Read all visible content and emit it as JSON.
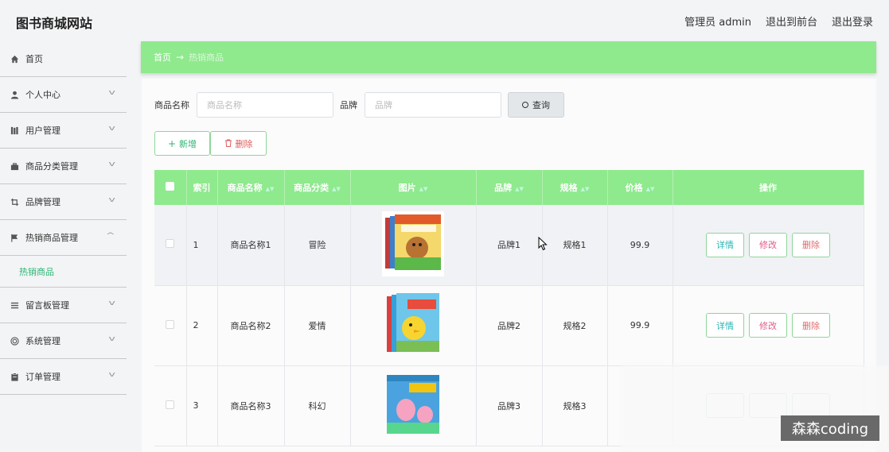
{
  "header": {
    "site_title": "图书商城网站",
    "admin_label": "管理员 admin",
    "front_link": "退出到前台",
    "logout_link": "退出登录"
  },
  "sidebar": {
    "items": [
      {
        "label": "首页",
        "icon": "home-icon"
      },
      {
        "label": "个人中心",
        "icon": "user-icon"
      },
      {
        "label": "用户管理",
        "icon": "books-icon"
      },
      {
        "label": "商品分类管理",
        "icon": "briefcase-icon"
      },
      {
        "label": "品牌管理",
        "icon": "crop-icon"
      },
      {
        "label": "热销商品管理",
        "icon": "flag-icon"
      },
      {
        "label": "留言板管理",
        "icon": "list-icon"
      },
      {
        "label": "系统管理",
        "icon": "settings-icon"
      },
      {
        "label": "订单管理",
        "icon": "clipboard-icon"
      }
    ],
    "active_sub": "热销商品"
  },
  "breadcrumb": {
    "home": "首页",
    "arrow": "→",
    "current": "热销商品"
  },
  "search": {
    "name_label": "商品名称",
    "name_placeholder": "商品名称",
    "brand_label": "品牌",
    "brand_placeholder": "品牌",
    "query_button": "查询"
  },
  "actions": {
    "add_label": "新增",
    "delete_label": "删除"
  },
  "table": {
    "headers": [
      "索引",
      "商品名称",
      "商品分类",
      "图片",
      "品牌",
      "规格",
      "价格",
      "操作"
    ],
    "rows": [
      {
        "index": "1",
        "name": "商品名称1",
        "category": "冒险",
        "brand": "品牌1",
        "spec": "规格1",
        "price": "99.9"
      },
      {
        "index": "2",
        "name": "商品名称2",
        "category": "爱情",
        "brand": "品牌2",
        "spec": "规格2",
        "price": "99.9"
      },
      {
        "index": "3",
        "name": "商品名称3",
        "category": "科幻",
        "brand": "品牌3",
        "spec": "规格3",
        "price": ""
      }
    ],
    "row_actions": {
      "detail": "详情",
      "edit": "修改",
      "remove": "删除"
    }
  },
  "watermark": "森森coding",
  "colors": {
    "accent_green": "#8fe98d",
    "text_green": "#2bb673",
    "danger": "#e05b5b"
  }
}
